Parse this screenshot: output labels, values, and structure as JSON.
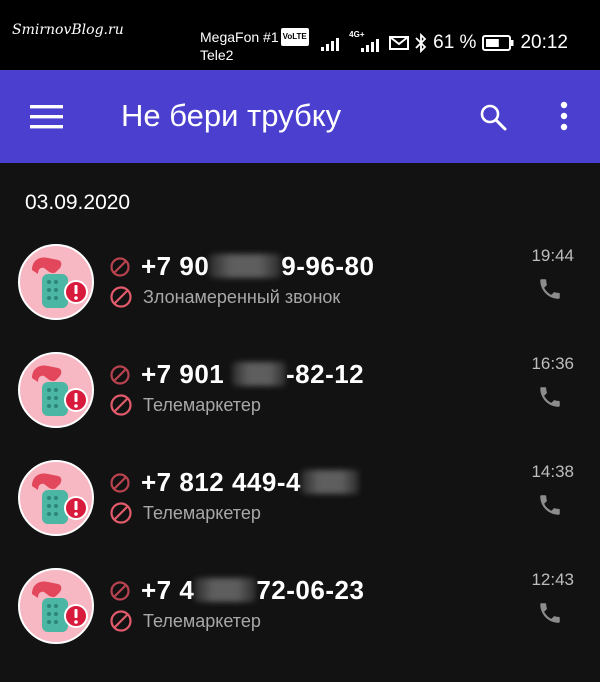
{
  "statusbar": {
    "watermark": "SmirnovBlog.ru",
    "carrier1": "MegaFon #1",
    "volte": "VoLTE",
    "carrier2": "Tele2",
    "network": "4G+",
    "battery_percent": "61 %",
    "time": "20:12",
    "battery_level": 0.61
  },
  "appbar": {
    "title": "Не бери трубку",
    "menu_icon": "hamburger-menu-icon",
    "search_icon": "search-icon",
    "more_icon": "more-vertical-icon"
  },
  "date_header": "03.09.2020",
  "colors": {
    "appbar": "#4a3fce",
    "background": "#121212",
    "avatar_bg": "#f7b7c3",
    "phone_red": "#e3475b",
    "phone_teal": "#4bb6a4",
    "alert_red": "#d81b3c",
    "block_icon_red": "#e25b6a"
  },
  "calls": [
    {
      "num_a": "+7 90",
      "num_b": "9-96-80",
      "category": "Злонамеренный звонок",
      "time": "19:44"
    },
    {
      "num_a": "+7 901 ",
      "num_b": "-82-12",
      "category": "Телемаркетер",
      "time": "16:36"
    },
    {
      "num_a": "+7 812 449-4",
      "num_b": "",
      "category": "Телемаркетер",
      "time": "14:38"
    },
    {
      "num_a": "+7 4",
      "num_b": "72-06-23",
      "category": "Телемаркетер",
      "time": "12:43"
    }
  ]
}
